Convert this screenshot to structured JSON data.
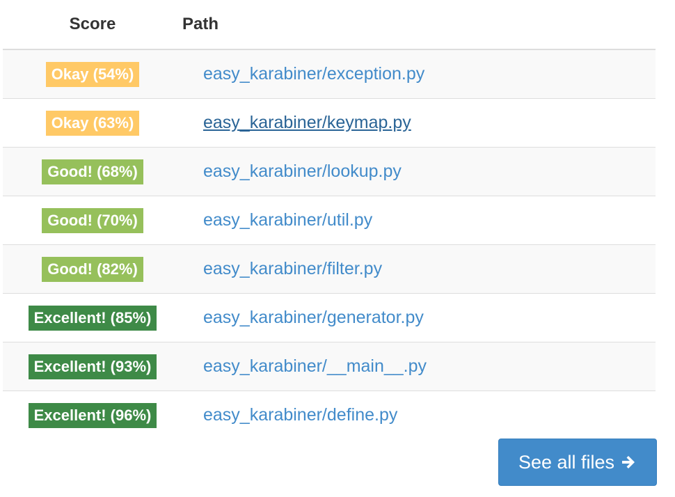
{
  "table": {
    "headers": {
      "score": "Score",
      "path": "Path"
    },
    "rows": [
      {
        "badge": "Okay (54%)",
        "level": "okay",
        "path": "easy_karabiner/exception.py",
        "hovered": false
      },
      {
        "badge": "Okay (63%)",
        "level": "okay",
        "path": "easy_karabiner/keymap.py",
        "hovered": true
      },
      {
        "badge": "Good! (68%)",
        "level": "good",
        "path": "easy_karabiner/lookup.py",
        "hovered": false
      },
      {
        "badge": "Good! (70%)",
        "level": "good",
        "path": "easy_karabiner/util.py",
        "hovered": false
      },
      {
        "badge": "Good! (82%)",
        "level": "good",
        "path": "easy_karabiner/filter.py",
        "hovered": false
      },
      {
        "badge": "Excellent! (85%)",
        "level": "excellent",
        "path": "easy_karabiner/generator.py",
        "hovered": false
      },
      {
        "badge": "Excellent! (93%)",
        "level": "excellent",
        "path": "easy_karabiner/__main__.py",
        "hovered": false
      },
      {
        "badge": "Excellent! (96%)",
        "level": "excellent",
        "path": "easy_karabiner/define.py",
        "hovered": false
      }
    ]
  },
  "see_all_button": {
    "label": "See all files",
    "icon": "arrow-right-icon"
  },
  "colors": {
    "okay": "#ffc966",
    "good": "#96c05b",
    "excellent": "#3e8a47",
    "link": "#428bca",
    "link_hover": "#2a6496",
    "button": "#428bca"
  }
}
